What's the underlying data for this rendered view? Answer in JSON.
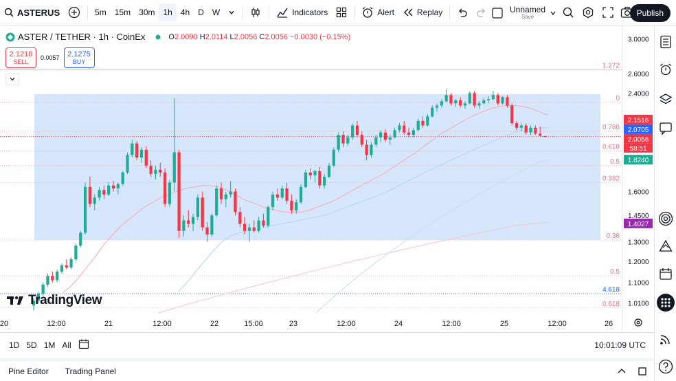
{
  "toolbar": {
    "symbol": "ASTERUS",
    "intervals": [
      "5m",
      "15m",
      "30m",
      "1h",
      "4h",
      "D",
      "W"
    ],
    "active_interval": "1h",
    "indicators_label": "Indicators",
    "alert_label": "Alert",
    "replay_label": "Replay",
    "layout_name": "Unnamed",
    "layout_status": "Save",
    "publish_label": "Publish"
  },
  "legend": {
    "title": "ASTER / TETHER · 1h · CoinEx",
    "o_label": "O",
    "o": "2.0090",
    "h_label": "H",
    "h": "2.0114",
    "l_label": "L",
    "l": "2.0056",
    "c_label": "C",
    "c": "2.0056",
    "change": "−0.0030 (−0.15%)"
  },
  "trade": {
    "sell_price": "2.1218",
    "sell_label": "SELL",
    "spread": "0.0057",
    "buy_price": "2.1275",
    "buy_label": "BUY"
  },
  "branding": "TradingView",
  "bottom": {
    "ranges": [
      "1D",
      "5D",
      "1M",
      "All"
    ],
    "clock": "10:01:09 UTC",
    "pine_editor": "Pine Editor",
    "trading_panel": "Trading Panel"
  },
  "colors": {
    "up": "#22ab94",
    "down": "#f23645",
    "fib_zone": "#cfe3fb",
    "ma_pink": "#f7a8b8",
    "ma_blue": "#b6d2ee"
  },
  "chart_data": {
    "type": "candlestick",
    "title": "ASTER / TETHER · 1h · CoinEx",
    "y_scale": "log",
    "ylim": [
      0.97,
      3.1
    ],
    "y_ticks": [
      3.0,
      2.6,
      2.4,
      1.6,
      1.45,
      1.3,
      1.2,
      1.1,
      1.01
    ],
    "y_tick_labels": [
      "3.0000",
      "2.6000",
      "2.4000",
      "1.6000",
      "1.4500",
      "1.3000",
      "1.2000",
      "1.1000",
      "1.0100"
    ],
    "x_ticks": [
      "20",
      "12:00",
      "21",
      "12:00",
      "22",
      "15:00",
      "23",
      "12:00",
      "24",
      "12:00",
      "25",
      "12:00",
      "26"
    ],
    "price_labels": [
      {
        "value": 2.1516,
        "text": "2.1516",
        "color": "#f23645"
      },
      {
        "value": 2.0705,
        "text": "2.0705",
        "color": "#2962ff"
      },
      {
        "value": 2.0056,
        "text": "2.0056",
        "color": "#f23645"
      },
      {
        "value": 1.824,
        "text": "1.8240",
        "color": "#22ab94"
      },
      {
        "value": 1.4027,
        "text": "1.4027",
        "color": "#9c27b0"
      }
    ],
    "countdown": "58:51",
    "fib_levels": [
      {
        "label": "1.272",
        "value": 2.64,
        "color": "#f7a8b8"
      },
      {
        "label": "0",
        "value": 2.31,
        "color": "#f7a8b8"
      },
      {
        "label": "0.786",
        "value": 2.05,
        "color": "#f7a8b8"
      },
      {
        "label": "0.618",
        "value": 1.89,
        "color": "#f7a8b8"
      },
      {
        "label": "0.5",
        "value": 1.78,
        "color": "#f7a8b8"
      },
      {
        "label": "0.382",
        "value": 1.66,
        "color": "#f7a8b8"
      },
      {
        "label": "0.38",
        "value": 1.31,
        "color": "#f7a8b8"
      },
      {
        "label": "0.5",
        "value": 1.13,
        "color": "#f7a8b8"
      },
      {
        "label": "4.618",
        "value": 1.05,
        "color": "#2962ff"
      },
      {
        "label": "0.618",
        "value": 0.99,
        "color": "#f7a8b8"
      }
    ],
    "zone": {
      "top": 2.39,
      "bottom": 1.31
    },
    "candles": [
      {
        "o": 1.0,
        "h": 1.03,
        "l": 0.98,
        "c": 1.02
      },
      {
        "o": 1.02,
        "h": 1.06,
        "l": 1.01,
        "c": 1.05
      },
      {
        "o": 1.05,
        "h": 1.1,
        "l": 1.04,
        "c": 1.09
      },
      {
        "o": 1.09,
        "h": 1.14,
        "l": 1.08,
        "c": 1.13
      },
      {
        "o": 1.13,
        "h": 1.15,
        "l": 1.1,
        "c": 1.11
      },
      {
        "o": 1.11,
        "h": 1.16,
        "l": 1.1,
        "c": 1.15
      },
      {
        "o": 1.15,
        "h": 1.19,
        "l": 1.14,
        "c": 1.18
      },
      {
        "o": 1.18,
        "h": 1.21,
        "l": 1.16,
        "c": 1.17
      },
      {
        "o": 1.17,
        "h": 1.22,
        "l": 1.16,
        "c": 1.21
      },
      {
        "o": 1.21,
        "h": 1.29,
        "l": 1.2,
        "c": 1.28
      },
      {
        "o": 1.28,
        "h": 1.36,
        "l": 1.27,
        "c": 1.35
      },
      {
        "o": 1.35,
        "h": 1.66,
        "l": 1.34,
        "c": 1.63
      },
      {
        "o": 1.63,
        "h": 1.7,
        "l": 1.5,
        "c": 1.52
      },
      {
        "o": 1.52,
        "h": 1.58,
        "l": 1.48,
        "c": 1.56
      },
      {
        "o": 1.56,
        "h": 1.63,
        "l": 1.54,
        "c": 1.61
      },
      {
        "o": 1.61,
        "h": 1.64,
        "l": 1.55,
        "c": 1.58
      },
      {
        "o": 1.58,
        "h": 1.66,
        "l": 1.57,
        "c": 1.64
      },
      {
        "o": 1.64,
        "h": 1.67,
        "l": 1.6,
        "c": 1.62
      },
      {
        "o": 1.62,
        "h": 1.66,
        "l": 1.58,
        "c": 1.65
      },
      {
        "o": 1.65,
        "h": 1.74,
        "l": 1.64,
        "c": 1.73
      },
      {
        "o": 1.73,
        "h": 1.88,
        "l": 1.72,
        "c": 1.86
      },
      {
        "o": 1.86,
        "h": 1.98,
        "l": 1.84,
        "c": 1.95
      },
      {
        "o": 1.95,
        "h": 1.97,
        "l": 1.82,
        "c": 1.84
      },
      {
        "o": 1.84,
        "h": 1.92,
        "l": 1.8,
        "c": 1.9
      },
      {
        "o": 1.9,
        "h": 1.93,
        "l": 1.76,
        "c": 1.78
      },
      {
        "o": 1.78,
        "h": 1.82,
        "l": 1.7,
        "c": 1.72
      },
      {
        "o": 1.72,
        "h": 1.78,
        "l": 1.68,
        "c": 1.75
      },
      {
        "o": 1.75,
        "h": 1.8,
        "l": 1.7,
        "c": 1.73
      },
      {
        "o": 1.73,
        "h": 1.76,
        "l": 1.5,
        "c": 1.52
      },
      {
        "o": 1.52,
        "h": 1.68,
        "l": 1.5,
        "c": 1.66
      },
      {
        "o": 1.66,
        "h": 2.35,
        "l": 1.6,
        "c": 1.88
      },
      {
        "o": 1.88,
        "h": 1.9,
        "l": 1.32,
        "c": 1.36
      },
      {
        "o": 1.36,
        "h": 1.45,
        "l": 1.33,
        "c": 1.42
      },
      {
        "o": 1.42,
        "h": 1.48,
        "l": 1.38,
        "c": 1.4
      },
      {
        "o": 1.4,
        "h": 1.46,
        "l": 1.36,
        "c": 1.44
      },
      {
        "o": 1.44,
        "h": 1.58,
        "l": 1.42,
        "c": 1.56
      },
      {
        "o": 1.56,
        "h": 1.6,
        "l": 1.36,
        "c": 1.38
      },
      {
        "o": 1.38,
        "h": 1.41,
        "l": 1.3,
        "c": 1.34
      },
      {
        "o": 1.34,
        "h": 1.46,
        "l": 1.33,
        "c": 1.45
      },
      {
        "o": 1.45,
        "h": 1.64,
        "l": 1.44,
        "c": 1.62
      },
      {
        "o": 1.62,
        "h": 1.66,
        "l": 1.52,
        "c": 1.55
      },
      {
        "o": 1.55,
        "h": 1.6,
        "l": 1.5,
        "c": 1.58
      },
      {
        "o": 1.58,
        "h": 1.67,
        "l": 1.56,
        "c": 1.6
      },
      {
        "o": 1.6,
        "h": 1.62,
        "l": 1.45,
        "c": 1.47
      },
      {
        "o": 1.47,
        "h": 1.5,
        "l": 1.38,
        "c": 1.4
      },
      {
        "o": 1.4,
        "h": 1.44,
        "l": 1.34,
        "c": 1.36
      },
      {
        "o": 1.36,
        "h": 1.4,
        "l": 1.3,
        "c": 1.38
      },
      {
        "o": 1.38,
        "h": 1.42,
        "l": 1.35,
        "c": 1.36
      },
      {
        "o": 1.36,
        "h": 1.44,
        "l": 1.35,
        "c": 1.42
      },
      {
        "o": 1.42,
        "h": 1.46,
        "l": 1.38,
        "c": 1.39
      },
      {
        "o": 1.39,
        "h": 1.51,
        "l": 1.38,
        "c": 1.5
      },
      {
        "o": 1.5,
        "h": 1.6,
        "l": 1.48,
        "c": 1.58
      },
      {
        "o": 1.58,
        "h": 1.62,
        "l": 1.54,
        "c": 1.56
      },
      {
        "o": 1.56,
        "h": 1.64,
        "l": 1.55,
        "c": 1.62
      },
      {
        "o": 1.62,
        "h": 1.66,
        "l": 1.52,
        "c": 1.54
      },
      {
        "o": 1.54,
        "h": 1.58,
        "l": 1.46,
        "c": 1.48
      },
      {
        "o": 1.48,
        "h": 1.55,
        "l": 1.46,
        "c": 1.53
      },
      {
        "o": 1.53,
        "h": 1.65,
        "l": 1.52,
        "c": 1.63
      },
      {
        "o": 1.63,
        "h": 1.75,
        "l": 1.62,
        "c": 1.73
      },
      {
        "o": 1.73,
        "h": 1.76,
        "l": 1.68,
        "c": 1.71
      },
      {
        "o": 1.71,
        "h": 1.75,
        "l": 1.66,
        "c": 1.74
      },
      {
        "o": 1.74,
        "h": 1.77,
        "l": 1.62,
        "c": 1.64
      },
      {
        "o": 1.64,
        "h": 1.72,
        "l": 1.62,
        "c": 1.7
      },
      {
        "o": 1.7,
        "h": 1.8,
        "l": 1.69,
        "c": 1.78
      },
      {
        "o": 1.78,
        "h": 1.92,
        "l": 1.77,
        "c": 1.9
      },
      {
        "o": 1.9,
        "h": 2.04,
        "l": 1.88,
        "c": 2.02
      },
      {
        "o": 2.02,
        "h": 2.05,
        "l": 1.92,
        "c": 1.95
      },
      {
        "o": 1.95,
        "h": 2.02,
        "l": 1.93,
        "c": 2.0
      },
      {
        "o": 2.0,
        "h": 2.12,
        "l": 1.98,
        "c": 2.1
      },
      {
        "o": 2.1,
        "h": 2.14,
        "l": 2.0,
        "c": 2.02
      },
      {
        "o": 2.02,
        "h": 2.05,
        "l": 1.92,
        "c": 1.94
      },
      {
        "o": 1.94,
        "h": 1.98,
        "l": 1.82,
        "c": 1.86
      },
      {
        "o": 1.86,
        "h": 1.96,
        "l": 1.84,
        "c": 1.94
      },
      {
        "o": 1.94,
        "h": 2.02,
        "l": 1.92,
        "c": 2.0
      },
      {
        "o": 2.0,
        "h": 2.06,
        "l": 1.96,
        "c": 2.04
      },
      {
        "o": 2.04,
        "h": 2.07,
        "l": 1.96,
        "c": 1.98
      },
      {
        "o": 1.98,
        "h": 2.02,
        "l": 1.94,
        "c": 2.0
      },
      {
        "o": 2.0,
        "h": 2.08,
        "l": 1.99,
        "c": 2.06
      },
      {
        "o": 2.06,
        "h": 2.12,
        "l": 2.04,
        "c": 2.1
      },
      {
        "o": 2.1,
        "h": 2.14,
        "l": 2.02,
        "c": 2.04
      },
      {
        "o": 2.04,
        "h": 2.08,
        "l": 2.0,
        "c": 2.02
      },
      {
        "o": 2.02,
        "h": 2.08,
        "l": 2.0,
        "c": 2.06
      },
      {
        "o": 2.06,
        "h": 2.16,
        "l": 2.05,
        "c": 2.14
      },
      {
        "o": 2.14,
        "h": 2.18,
        "l": 2.08,
        "c": 2.1
      },
      {
        "o": 2.1,
        "h": 2.2,
        "l": 2.09,
        "c": 2.18
      },
      {
        "o": 2.18,
        "h": 2.28,
        "l": 2.17,
        "c": 2.26
      },
      {
        "o": 2.26,
        "h": 2.3,
        "l": 2.22,
        "c": 2.28
      },
      {
        "o": 2.28,
        "h": 2.34,
        "l": 2.26,
        "c": 2.32
      },
      {
        "o": 2.32,
        "h": 2.44,
        "l": 2.31,
        "c": 2.38
      },
      {
        "o": 2.38,
        "h": 2.4,
        "l": 2.28,
        "c": 2.3
      },
      {
        "o": 2.3,
        "h": 2.34,
        "l": 2.27,
        "c": 2.33
      },
      {
        "o": 2.33,
        "h": 2.36,
        "l": 2.26,
        "c": 2.28
      },
      {
        "o": 2.28,
        "h": 2.32,
        "l": 2.25,
        "c": 2.3
      },
      {
        "o": 2.3,
        "h": 2.42,
        "l": 2.29,
        "c": 2.4
      },
      {
        "o": 2.4,
        "h": 2.42,
        "l": 2.26,
        "c": 2.28
      },
      {
        "o": 2.28,
        "h": 2.32,
        "l": 2.25,
        "c": 2.3
      },
      {
        "o": 2.3,
        "h": 2.35,
        "l": 2.29,
        "c": 2.33
      },
      {
        "o": 2.33,
        "h": 2.37,
        "l": 2.3,
        "c": 2.34
      },
      {
        "o": 2.34,
        "h": 2.42,
        "l": 2.33,
        "c": 2.38
      },
      {
        "o": 2.38,
        "h": 2.4,
        "l": 2.28,
        "c": 2.3
      },
      {
        "o": 2.3,
        "h": 2.37,
        "l": 2.29,
        "c": 2.36
      },
      {
        "o": 2.36,
        "h": 2.38,
        "l": 2.26,
        "c": 2.28
      },
      {
        "o": 2.28,
        "h": 2.3,
        "l": 2.1,
        "c": 2.12
      },
      {
        "o": 2.12,
        "h": 2.14,
        "l": 2.06,
        "c": 2.08
      },
      {
        "o": 2.08,
        "h": 2.12,
        "l": 2.05,
        "c": 2.1
      },
      {
        "o": 2.1,
        "h": 2.12,
        "l": 2.02,
        "c": 2.04
      },
      {
        "o": 2.04,
        "h": 2.1,
        "l": 2.02,
        "c": 2.08
      },
      {
        "o": 2.08,
        "h": 2.1,
        "l": 2.02,
        "c": 2.03
      },
      {
        "o": 2.03,
        "h": 2.09,
        "l": 2.01,
        "c": 2.0146
      },
      {
        "o": 2.009,
        "h": 2.0114,
        "l": 2.0056,
        "c": 2.0056
      }
    ],
    "ma_pink": [
      1.05,
      1.08,
      1.12,
      1.17,
      1.22,
      1.28,
      1.33,
      1.38,
      1.42,
      1.46,
      1.5,
      1.53,
      1.56,
      1.58,
      1.6,
      1.62,
      1.63,
      1.64,
      1.64,
      1.63,
      1.61,
      1.58,
      1.55,
      1.53,
      1.51,
      1.49,
      1.48,
      1.47,
      1.47,
      1.47,
      1.48,
      1.5,
      1.52,
      1.54,
      1.57,
      1.6,
      1.63,
      1.66,
      1.69,
      1.72,
      1.76,
      1.8,
      1.84,
      1.88,
      1.93,
      1.98,
      2.03,
      2.07,
      2.11,
      2.15,
      2.19,
      2.22,
      2.25,
      2.27,
      2.28,
      2.28,
      2.27,
      2.25,
      2.22,
      2.19
    ],
    "ma_blue": [
      1.06,
      1.1,
      1.15,
      1.2,
      1.25,
      1.3,
      1.33,
      1.35,
      1.36,
      1.37,
      1.38,
      1.39,
      1.4,
      1.41,
      1.42,
      1.43,
      1.44,
      1.45,
      1.47,
      1.49,
      1.51,
      1.53,
      1.55,
      1.57,
      1.59,
      1.62,
      1.65,
      1.68,
      1.71,
      1.74,
      1.77,
      1.8,
      1.83,
      1.86,
      1.89,
      1.92,
      1.95,
      1.98,
      2.01,
      2.04,
      2.06,
      2.07,
      2.08,
      2.08
    ],
    "ma_long_pink": [
      0.97,
      0.99,
      1.01,
      1.03,
      1.05,
      1.07,
      1.09,
      1.11,
      1.13,
      1.15,
      1.17,
      1.19,
      1.21,
      1.23,
      1.25,
      1.27,
      1.29,
      1.31,
      1.33,
      1.35,
      1.37,
      1.39,
      1.4,
      1.41
    ],
    "ma_long_blue": [
      0.97,
      1.0,
      1.03,
      1.06,
      1.09,
      1.12,
      1.15,
      1.18,
      1.21,
      1.24,
      1.27,
      1.3,
      1.33,
      1.36,
      1.39,
      1.42,
      1.45,
      1.48,
      1.51,
      1.54,
      1.57,
      1.6,
      1.63,
      1.66,
      1.69,
      1.72,
      1.75,
      1.78,
      1.81,
      1.82
    ]
  }
}
